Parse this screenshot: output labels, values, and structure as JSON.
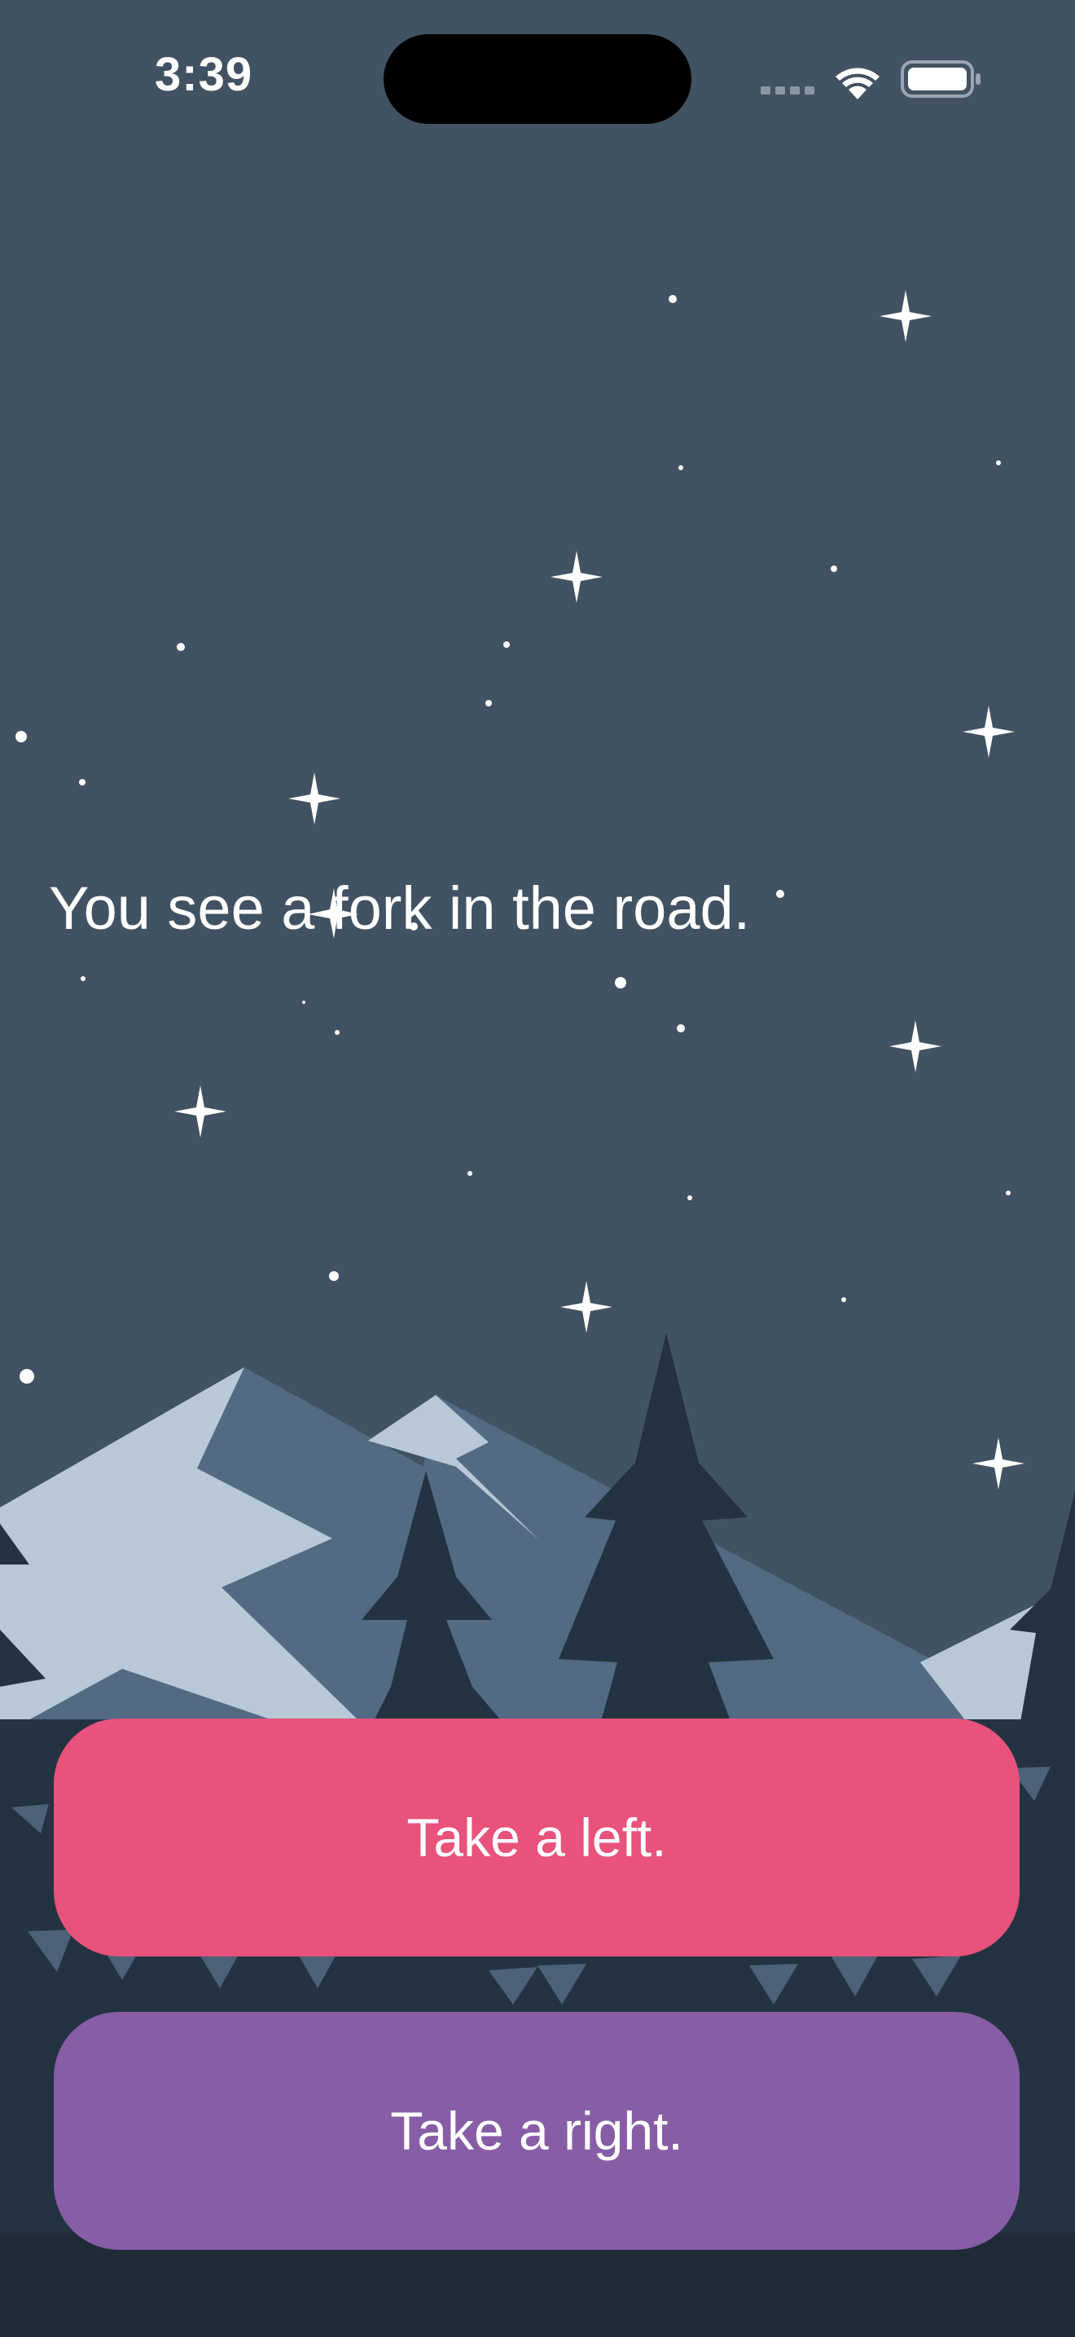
{
  "status_bar": {
    "time": "3:39"
  },
  "story": {
    "prompt": "You see a fork in the road."
  },
  "choices": [
    {
      "label": "Take a left.",
      "color": "#E8527B"
    },
    {
      "label": "Take a right.",
      "color": "#875EA6"
    }
  ],
  "colors": {
    "sky": "#415262",
    "mountain_light": "#B8C8D6",
    "mountain_mid": "#536A84",
    "tree_dark": "#243341",
    "tree_far": "#4D6278",
    "ground": "#1F2C38",
    "star": "#FFFFFF"
  }
}
